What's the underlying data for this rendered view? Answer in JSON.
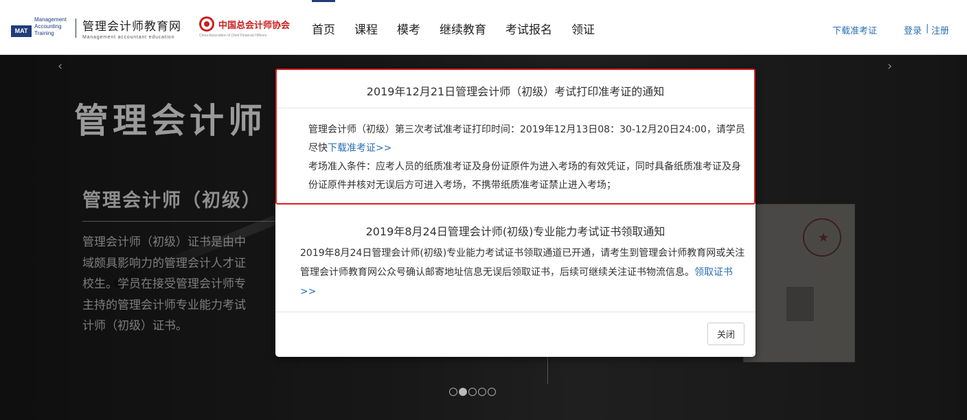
{
  "header": {
    "mat_logo": {
      "abbr": "MAT",
      "line1": "Management",
      "line2": "Accounting",
      "line3": "Training"
    },
    "brand_cn": "管理会计师教育网",
    "brand_en": "Management accountant education",
    "partner_cn": "中国总会计师协会",
    "partner_en": "China Association of Chief Financial Officers",
    "nav": [
      "首页",
      "课程",
      "模考",
      "继续教育",
      "考试报名",
      "领证"
    ],
    "active_nav": "首页",
    "download_label": "下载准考证",
    "login_label": "登录",
    "sep": "|",
    "register_label": "注册"
  },
  "hero": {
    "title": "管理会计师",
    "subtitle": "管理会计师（初级）",
    "lines": [
      "管理会计师（初级）证书是由中",
      "域颇具影响力的管理会计人才证",
      "校生。学员在接受管理会计师专",
      "主持的管理会计师专业能力考试",
      "计师（初级）证书。"
    ],
    "prev_arrow": "‹",
    "next_arrow": "›",
    "slide_count": 5,
    "active_slide": 2
  },
  "modal": {
    "notice1": {
      "title": "2019年12月21日管理会计师（初级）考试打印准考证的通知",
      "p1_text": "管理会计师（初级）第三次考试准考证打印时间：2019年12月13日08：30-12月20日24:00，请学员尽快",
      "p1_link": "下载准考证>>",
      "p2_text": "考场准入条件：应考人员的纸质准考证及身份证原件为进入考场的有效凭证，同时具备纸质准考证及身份证原件并核对无误后方可进入考场，不携带纸质准考证禁止进入考场；"
    },
    "notice2": {
      "title": "2019年8月24日管理会计师(初级)专业能力考试证书领取通知",
      "text": "2019年8月24日管理会计师(初级)专业能力考试证书领取通道已开通，请考生到管理会计师教育网或关注管理会计师教育网公众号确认邮寄地址信息无误后领取证书，后续可继续关注证书物流信息。",
      "link": "领取证书>>"
    },
    "close_label": "关闭"
  }
}
